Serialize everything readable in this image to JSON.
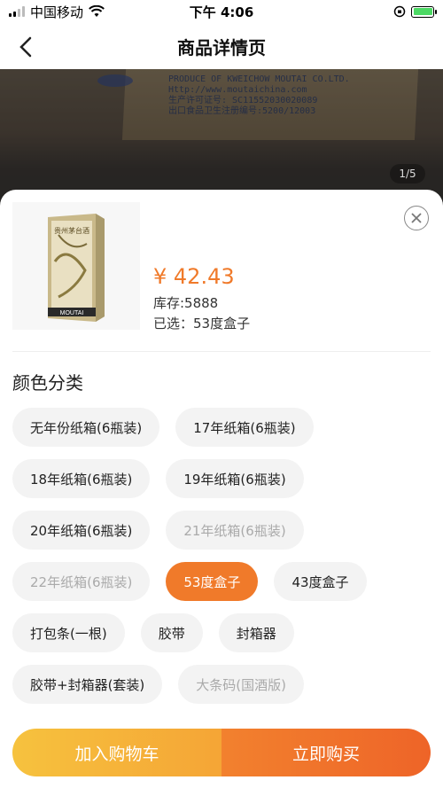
{
  "status_bar": {
    "carrier": "中国移动",
    "time": "下午 4:06",
    "battery_color": "#4cd964"
  },
  "nav": {
    "title": "商品详情页",
    "back_icon": "chevron-left-icon"
  },
  "banner": {
    "page_indicator": "1/5",
    "box_text": "PRODUCE OF KWEICHOW MOUTAI CO.LTD.\nHttp://www.moutaichina.com\n生产许可证号: SC11552030020089\n出口食品卫生注册编号:5200/12003"
  },
  "product": {
    "price": "¥ 42.43",
    "stock": "库存:5888",
    "selected": "已选：53度盒子",
    "close_icon": "close-circle-icon",
    "image_label": "贵州茅台酒"
  },
  "options_section": {
    "title": "颜色分类",
    "items": [
      {
        "label": "无年份纸箱(6瓶装)",
        "state": "normal"
      },
      {
        "label": "17年纸箱(6瓶装)",
        "state": "normal"
      },
      {
        "label": "18年纸箱(6瓶装)",
        "state": "normal"
      },
      {
        "label": "19年纸箱(6瓶装)",
        "state": "normal"
      },
      {
        "label": "20年纸箱(6瓶装)",
        "state": "normal"
      },
      {
        "label": "21年纸箱(6瓶装)",
        "state": "disabled"
      },
      {
        "label": "22年纸箱(6瓶装)",
        "state": "disabled"
      },
      {
        "label": "53度盒子",
        "state": "active"
      },
      {
        "label": "43度盒子",
        "state": "normal"
      },
      {
        "label": "打包条(一根)",
        "state": "normal"
      },
      {
        "label": "胶带",
        "state": "normal"
      },
      {
        "label": "封箱器",
        "state": "normal"
      },
      {
        "label": "胶带+封箱器(套装)",
        "state": "normal"
      },
      {
        "label": "大条码(国酒版)",
        "state": "disabled"
      }
    ]
  },
  "actions": {
    "add_to_cart": "加入购物车",
    "buy_now": "立即购买"
  },
  "colors": {
    "accent": "#f07a2a",
    "cart_gradient_start": "#f6c23e",
    "buy_gradient_end": "#ee6428"
  }
}
